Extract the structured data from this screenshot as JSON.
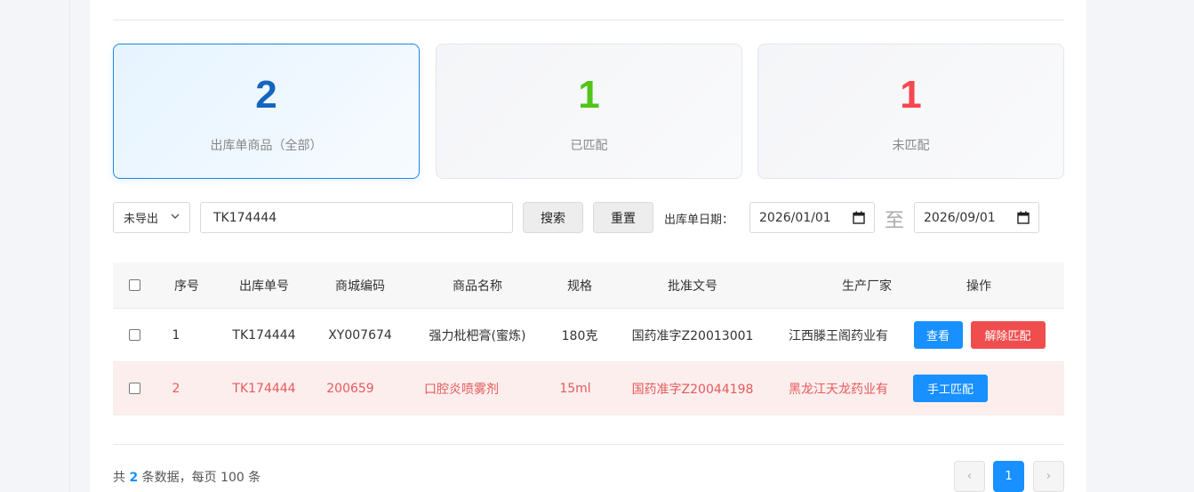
{
  "stats": {
    "total": {
      "value": "2",
      "label": "出库单商品（全部）",
      "color": "#1565c0"
    },
    "matched": {
      "value": "1",
      "label": "已匹配",
      "color": "#52c41a"
    },
    "unmatched": {
      "value": "1",
      "label": "未匹配",
      "color": "#f5474f"
    }
  },
  "filters": {
    "export_status": "未导出",
    "search_value": "TK174444",
    "search_button": "搜索",
    "reset_button": "重置",
    "date_label": "出库单日期：",
    "date_from": "2026/01/01",
    "date_separator": "至",
    "date_to": "2026/09/01"
  },
  "table": {
    "headers": {
      "index": "序号",
      "order_no": "出库单号",
      "mall_code": "商城编码",
      "product_name": "商品名称",
      "spec": "规格",
      "approval_no": "批准文号",
      "manufacturer": "生产厂家",
      "actions": "操作"
    },
    "rows": [
      {
        "index": "1",
        "order_no": "TK174444",
        "mall_code": "XY007674",
        "product_name": "强力枇杷膏(蜜炼)",
        "spec": "180克",
        "approval_no": "国药准字Z20013001",
        "manufacturer": "江西滕王阁药业有",
        "action1": "查看",
        "action2": "解除匹配"
      },
      {
        "index": "2",
        "order_no": "TK174444",
        "mall_code": "200659",
        "product_name": "口腔炎喷雾剂",
        "spec": "15ml",
        "approval_no": "国药准字Z20044198",
        "manufacturer": "黑龙江天龙药业有",
        "action1": "手工匹配"
      }
    ]
  },
  "footer": {
    "prefix": "共",
    "total": "2",
    "suffix": "条数据，每页 100 条",
    "prev": "‹",
    "current_page": "1",
    "next": "›"
  }
}
